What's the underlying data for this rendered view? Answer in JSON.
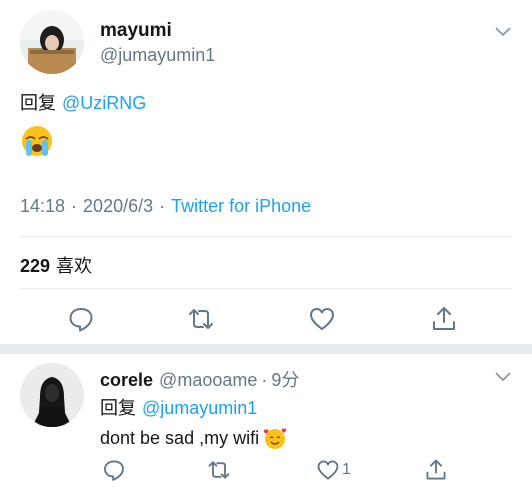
{
  "tweet": {
    "display_name": "mayumi",
    "handle": "@jumayumin1",
    "reply_label": "回复",
    "reply_to": "@UziRNG",
    "time": "14:18",
    "date": "2020/6/3",
    "separator": "·",
    "source": "Twitter for iPhone",
    "likes_count": "229",
    "likes_label": "喜欢",
    "emoji": "loudly-crying-face"
  },
  "reply": {
    "display_name": "corele",
    "handle": "@maooame",
    "separator": "·",
    "age": "9分",
    "reply_label": "回复",
    "reply_to": "@jumayumin1",
    "text": "dont be sad ,my wifi",
    "emoji": "smiling-face-with-hearts",
    "like_count": "1"
  },
  "icons": {
    "reply": "comment-icon",
    "retweet": "retweet-icon",
    "like": "heart-icon",
    "share": "share-icon",
    "menu": "chevron-down-icon"
  },
  "colors": {
    "link": "#1da1f2",
    "secondary": "#657786",
    "divider": "#e6ecf0",
    "text": "#14171a"
  }
}
